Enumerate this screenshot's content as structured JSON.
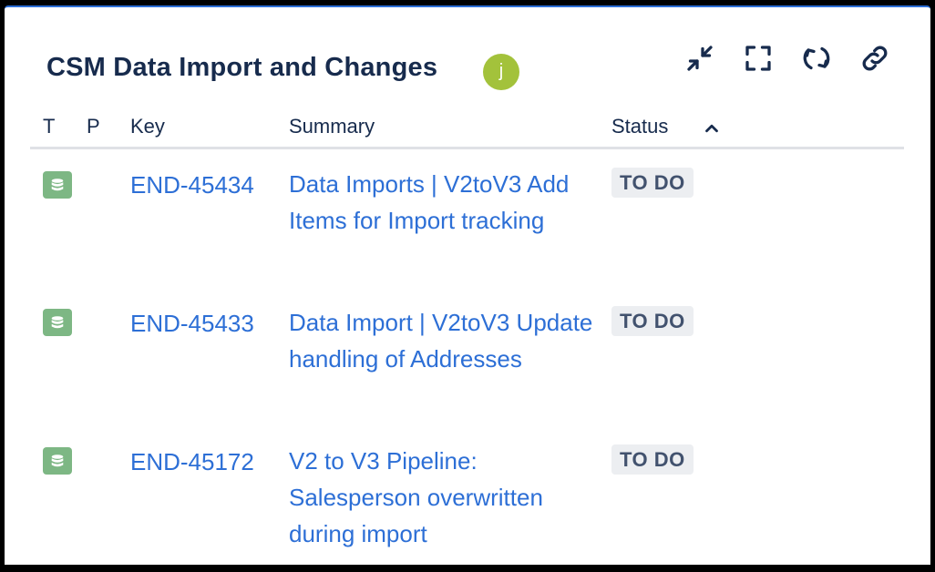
{
  "gadget": {
    "title": "CSM Data Import and Changes",
    "avatar_initial": "j",
    "toolbar": [
      {
        "name": "minimize-icon"
      },
      {
        "name": "expand-icon"
      },
      {
        "name": "refresh-icon"
      },
      {
        "name": "link-icon"
      }
    ]
  },
  "table": {
    "headers": {
      "t": "T",
      "p": "P",
      "key": "Key",
      "summary": "Summary",
      "status": "Status"
    },
    "sort_icon": "chevron-up-icon",
    "rows": [
      {
        "type_icon": "database-icon",
        "key": "END-45434",
        "summary": "Data Imports | V2toV3 Add Items for Import tracking",
        "status": "TO DO"
      },
      {
        "type_icon": "database-icon",
        "key": "END-45433",
        "summary": "Data Import | V2toV3 Update handling of Addresses",
        "status": "TO DO"
      },
      {
        "type_icon": "database-icon",
        "key": "END-45172",
        "summary": "V2 to V3 Pipeline: Salesperson overwritten during import",
        "status": "TO DO"
      }
    ]
  },
  "colors": {
    "link": "#2d6fd6",
    "accent_border": "#2d6fd6",
    "avatar": "#a3c23b",
    "type_icon": "#7db784",
    "lozenge_bg": "#eceef1"
  }
}
